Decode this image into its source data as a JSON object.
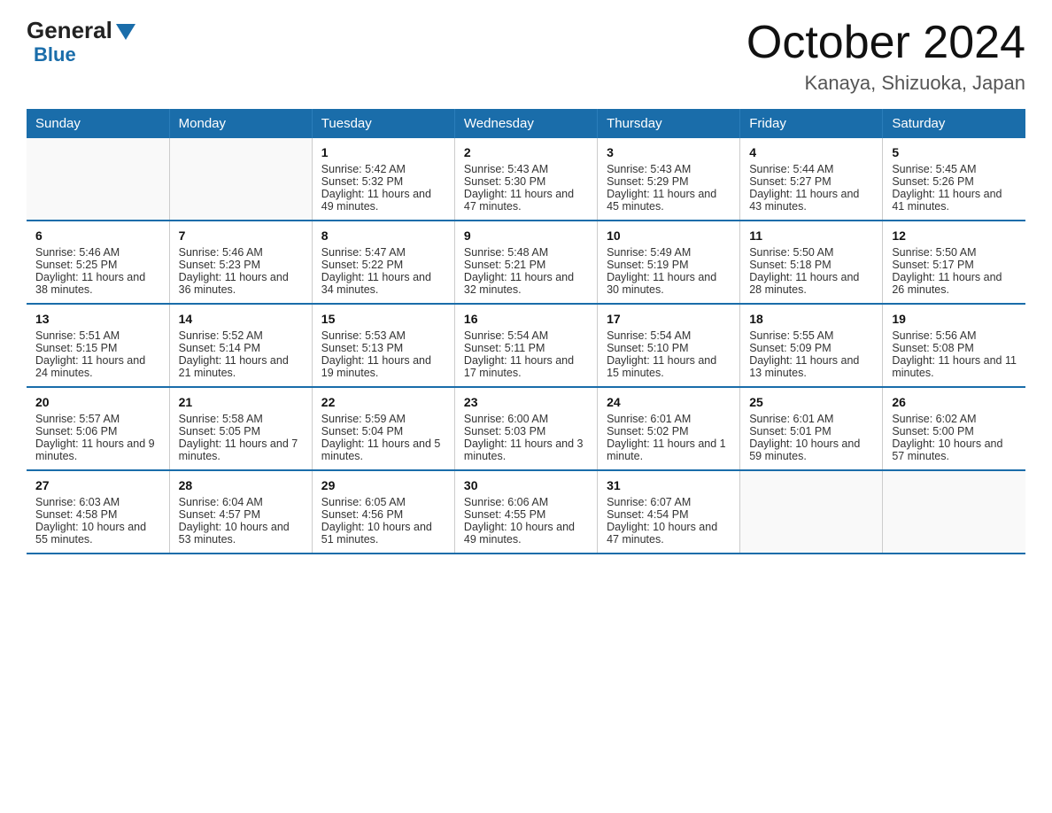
{
  "logo": {
    "general": "General",
    "blue": "Blue"
  },
  "title": "October 2024",
  "location": "Kanaya, Shizuoka, Japan",
  "days_header": [
    "Sunday",
    "Monday",
    "Tuesday",
    "Wednesday",
    "Thursday",
    "Friday",
    "Saturday"
  ],
  "weeks": [
    [
      {
        "day": "",
        "sunrise": "",
        "sunset": "",
        "daylight": "",
        "empty": true
      },
      {
        "day": "",
        "sunrise": "",
        "sunset": "",
        "daylight": "",
        "empty": true
      },
      {
        "day": "1",
        "sunrise": "Sunrise: 5:42 AM",
        "sunset": "Sunset: 5:32 PM",
        "daylight": "Daylight: 11 hours and 49 minutes.",
        "empty": false
      },
      {
        "day": "2",
        "sunrise": "Sunrise: 5:43 AM",
        "sunset": "Sunset: 5:30 PM",
        "daylight": "Daylight: 11 hours and 47 minutes.",
        "empty": false
      },
      {
        "day": "3",
        "sunrise": "Sunrise: 5:43 AM",
        "sunset": "Sunset: 5:29 PM",
        "daylight": "Daylight: 11 hours and 45 minutes.",
        "empty": false
      },
      {
        "day": "4",
        "sunrise": "Sunrise: 5:44 AM",
        "sunset": "Sunset: 5:27 PM",
        "daylight": "Daylight: 11 hours and 43 minutes.",
        "empty": false
      },
      {
        "day": "5",
        "sunrise": "Sunrise: 5:45 AM",
        "sunset": "Sunset: 5:26 PM",
        "daylight": "Daylight: 11 hours and 41 minutes.",
        "empty": false
      }
    ],
    [
      {
        "day": "6",
        "sunrise": "Sunrise: 5:46 AM",
        "sunset": "Sunset: 5:25 PM",
        "daylight": "Daylight: 11 hours and 38 minutes.",
        "empty": false
      },
      {
        "day": "7",
        "sunrise": "Sunrise: 5:46 AM",
        "sunset": "Sunset: 5:23 PM",
        "daylight": "Daylight: 11 hours and 36 minutes.",
        "empty": false
      },
      {
        "day": "8",
        "sunrise": "Sunrise: 5:47 AM",
        "sunset": "Sunset: 5:22 PM",
        "daylight": "Daylight: 11 hours and 34 minutes.",
        "empty": false
      },
      {
        "day": "9",
        "sunrise": "Sunrise: 5:48 AM",
        "sunset": "Sunset: 5:21 PM",
        "daylight": "Daylight: 11 hours and 32 minutes.",
        "empty": false
      },
      {
        "day": "10",
        "sunrise": "Sunrise: 5:49 AM",
        "sunset": "Sunset: 5:19 PM",
        "daylight": "Daylight: 11 hours and 30 minutes.",
        "empty": false
      },
      {
        "day": "11",
        "sunrise": "Sunrise: 5:50 AM",
        "sunset": "Sunset: 5:18 PM",
        "daylight": "Daylight: 11 hours and 28 minutes.",
        "empty": false
      },
      {
        "day": "12",
        "sunrise": "Sunrise: 5:50 AM",
        "sunset": "Sunset: 5:17 PM",
        "daylight": "Daylight: 11 hours and 26 minutes.",
        "empty": false
      }
    ],
    [
      {
        "day": "13",
        "sunrise": "Sunrise: 5:51 AM",
        "sunset": "Sunset: 5:15 PM",
        "daylight": "Daylight: 11 hours and 24 minutes.",
        "empty": false
      },
      {
        "day": "14",
        "sunrise": "Sunrise: 5:52 AM",
        "sunset": "Sunset: 5:14 PM",
        "daylight": "Daylight: 11 hours and 21 minutes.",
        "empty": false
      },
      {
        "day": "15",
        "sunrise": "Sunrise: 5:53 AM",
        "sunset": "Sunset: 5:13 PM",
        "daylight": "Daylight: 11 hours and 19 minutes.",
        "empty": false
      },
      {
        "day": "16",
        "sunrise": "Sunrise: 5:54 AM",
        "sunset": "Sunset: 5:11 PM",
        "daylight": "Daylight: 11 hours and 17 minutes.",
        "empty": false
      },
      {
        "day": "17",
        "sunrise": "Sunrise: 5:54 AM",
        "sunset": "Sunset: 5:10 PM",
        "daylight": "Daylight: 11 hours and 15 minutes.",
        "empty": false
      },
      {
        "day": "18",
        "sunrise": "Sunrise: 5:55 AM",
        "sunset": "Sunset: 5:09 PM",
        "daylight": "Daylight: 11 hours and 13 minutes.",
        "empty": false
      },
      {
        "day": "19",
        "sunrise": "Sunrise: 5:56 AM",
        "sunset": "Sunset: 5:08 PM",
        "daylight": "Daylight: 11 hours and 11 minutes.",
        "empty": false
      }
    ],
    [
      {
        "day": "20",
        "sunrise": "Sunrise: 5:57 AM",
        "sunset": "Sunset: 5:06 PM",
        "daylight": "Daylight: 11 hours and 9 minutes.",
        "empty": false
      },
      {
        "day": "21",
        "sunrise": "Sunrise: 5:58 AM",
        "sunset": "Sunset: 5:05 PM",
        "daylight": "Daylight: 11 hours and 7 minutes.",
        "empty": false
      },
      {
        "day": "22",
        "sunrise": "Sunrise: 5:59 AM",
        "sunset": "Sunset: 5:04 PM",
        "daylight": "Daylight: 11 hours and 5 minutes.",
        "empty": false
      },
      {
        "day": "23",
        "sunrise": "Sunrise: 6:00 AM",
        "sunset": "Sunset: 5:03 PM",
        "daylight": "Daylight: 11 hours and 3 minutes.",
        "empty": false
      },
      {
        "day": "24",
        "sunrise": "Sunrise: 6:01 AM",
        "sunset": "Sunset: 5:02 PM",
        "daylight": "Daylight: 11 hours and 1 minute.",
        "empty": false
      },
      {
        "day": "25",
        "sunrise": "Sunrise: 6:01 AM",
        "sunset": "Sunset: 5:01 PM",
        "daylight": "Daylight: 10 hours and 59 minutes.",
        "empty": false
      },
      {
        "day": "26",
        "sunrise": "Sunrise: 6:02 AM",
        "sunset": "Sunset: 5:00 PM",
        "daylight": "Daylight: 10 hours and 57 minutes.",
        "empty": false
      }
    ],
    [
      {
        "day": "27",
        "sunrise": "Sunrise: 6:03 AM",
        "sunset": "Sunset: 4:58 PM",
        "daylight": "Daylight: 10 hours and 55 minutes.",
        "empty": false
      },
      {
        "day": "28",
        "sunrise": "Sunrise: 6:04 AM",
        "sunset": "Sunset: 4:57 PM",
        "daylight": "Daylight: 10 hours and 53 minutes.",
        "empty": false
      },
      {
        "day": "29",
        "sunrise": "Sunrise: 6:05 AM",
        "sunset": "Sunset: 4:56 PM",
        "daylight": "Daylight: 10 hours and 51 minutes.",
        "empty": false
      },
      {
        "day": "30",
        "sunrise": "Sunrise: 6:06 AM",
        "sunset": "Sunset: 4:55 PM",
        "daylight": "Daylight: 10 hours and 49 minutes.",
        "empty": false
      },
      {
        "day": "31",
        "sunrise": "Sunrise: 6:07 AM",
        "sunset": "Sunset: 4:54 PM",
        "daylight": "Daylight: 10 hours and 47 minutes.",
        "empty": false
      },
      {
        "day": "",
        "sunrise": "",
        "sunset": "",
        "daylight": "",
        "empty": true
      },
      {
        "day": "",
        "sunrise": "",
        "sunset": "",
        "daylight": "",
        "empty": true
      }
    ]
  ]
}
